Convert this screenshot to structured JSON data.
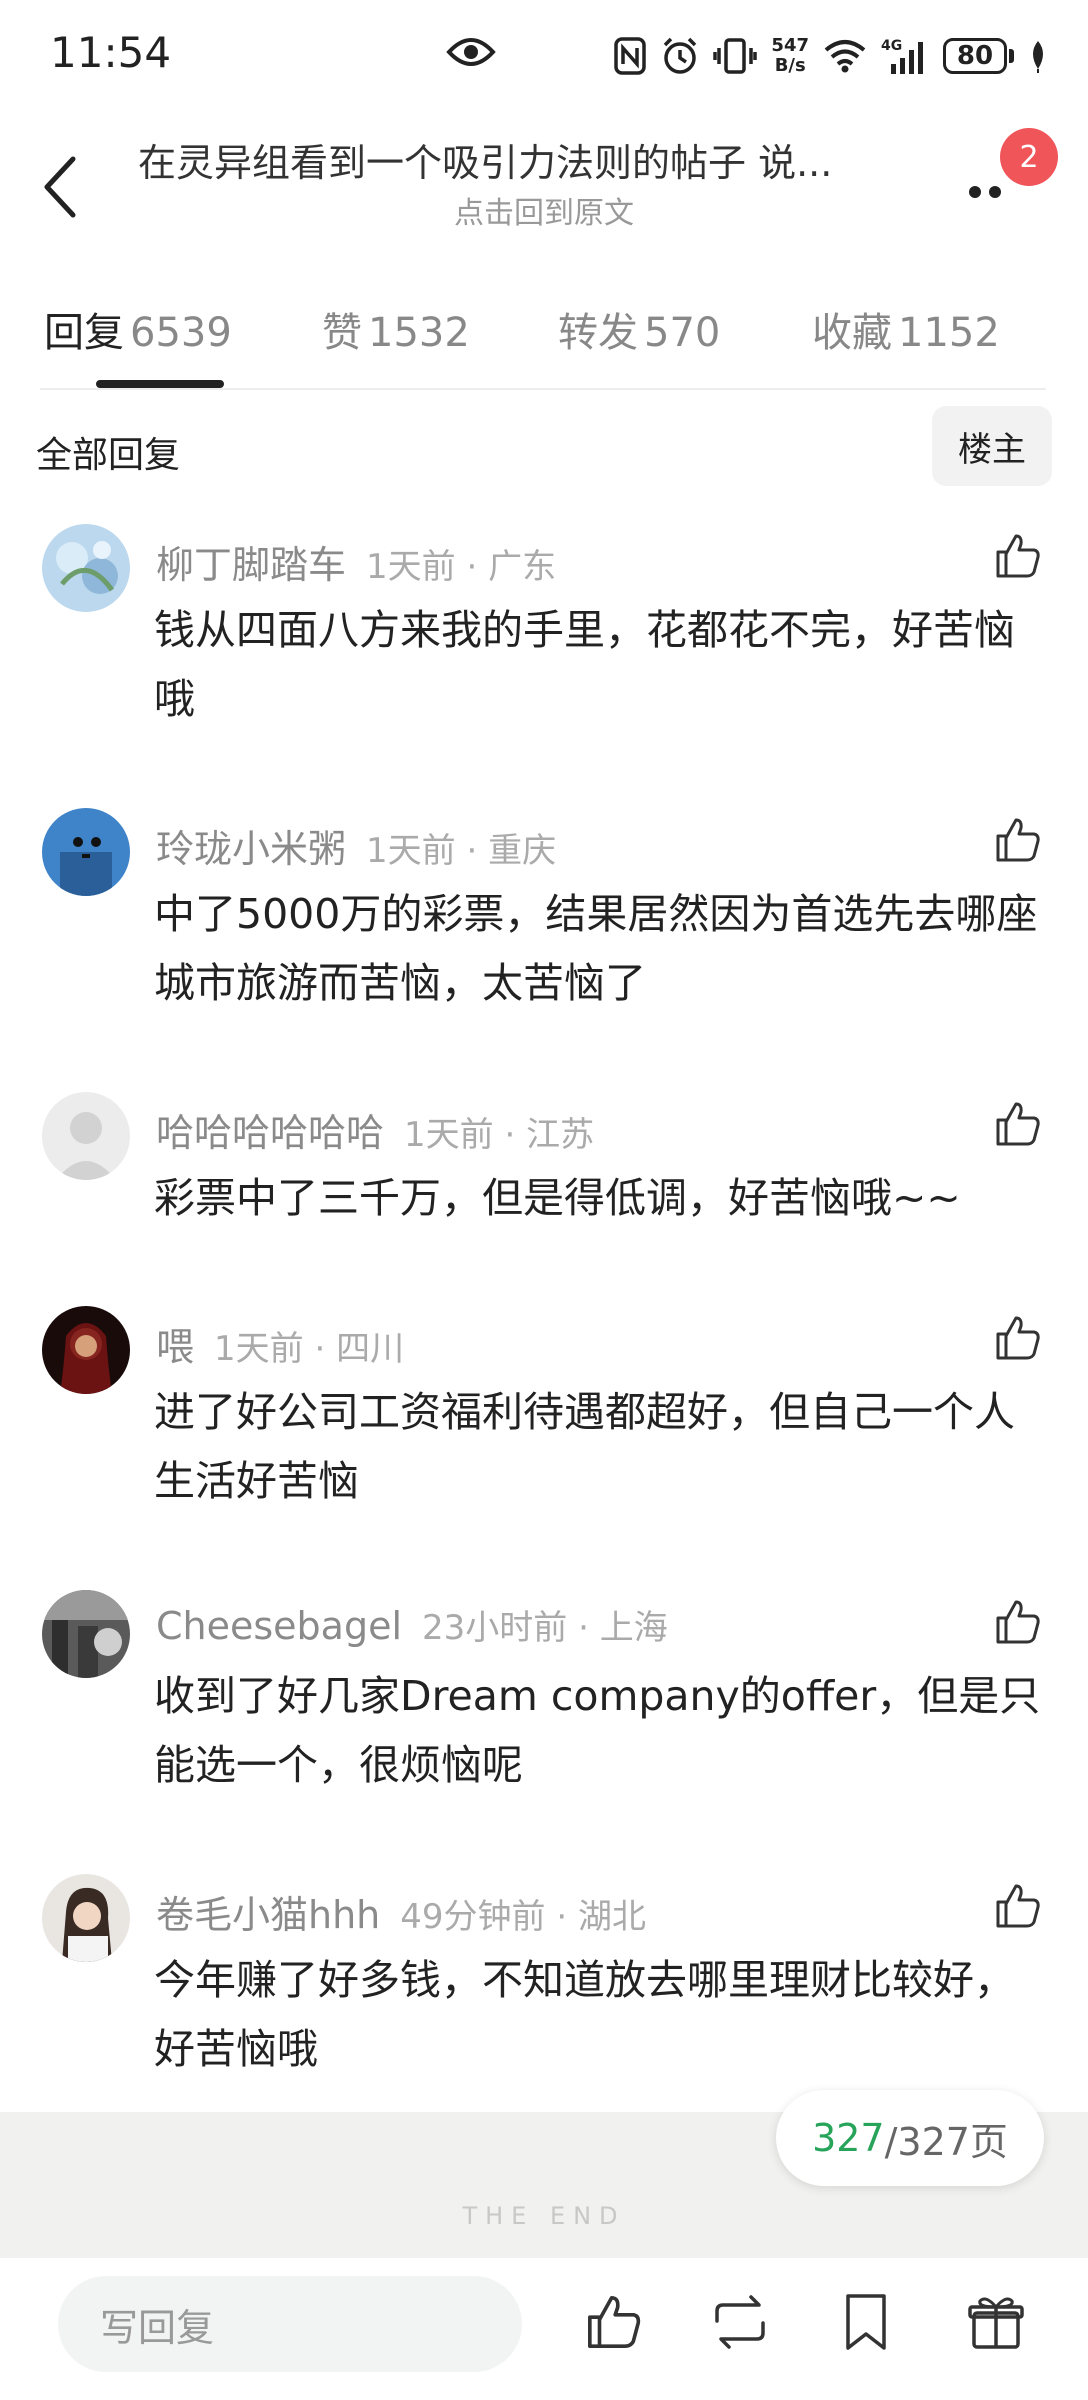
{
  "status_bar": {
    "time": "11:54",
    "net_speed_value": "547",
    "net_speed_unit": "B/s",
    "battery": "80",
    "icons": [
      "eye-icon",
      "nfc-icon",
      "alarm-icon",
      "vibrate-icon",
      "wifi-icon",
      "signal-4g-icon",
      "battery-icon",
      "leaf-icon"
    ]
  },
  "header": {
    "title": "在灵异组看到一个吸引力法则的帖子 说...",
    "subtitle": "点击回到原文",
    "badge_count": "2"
  },
  "tabs": [
    {
      "label": "回复",
      "count": "6539",
      "active": true
    },
    {
      "label": "赞",
      "count": "1532",
      "active": false
    },
    {
      "label": "转发",
      "count": "570",
      "active": false
    },
    {
      "label": "收藏",
      "count": "1152",
      "active": false
    }
  ],
  "filter": {
    "label": "全部回复",
    "owner_button": "楼主"
  },
  "comments": [
    {
      "username": "柳丁脚踏车",
      "time": "1天前",
      "location": "广东",
      "text": "钱从四面八方来我的手里，花都花不完，好苦恼哦"
    },
    {
      "username": "玲珑小米粥",
      "time": "1天前",
      "location": "重庆",
      "text": "中了5000万的彩票，结果居然因为首选先去哪座城市旅游而苦恼，太苦恼了"
    },
    {
      "username": "哈哈哈哈哈哈",
      "time": "1天前",
      "location": "江苏",
      "text": "彩票中了三千万，但是得低调，好苦恼哦~~"
    },
    {
      "username": "喂",
      "time": "1天前",
      "location": "四川",
      "text": "进了好公司工资福利待遇都超好，但自己一个人生活好苦恼"
    },
    {
      "username": "Cheesebagel",
      "time": "23小时前",
      "location": "上海",
      "text": "收到了好几家Dream company的offer，但是只能选一个，很烦恼呢"
    },
    {
      "username": "卷毛小猫hhh",
      "time": "49分钟前",
      "location": "湖北",
      "text": "今年赚了好多钱，不知道放去哪里理财比较好，好苦恼哦"
    }
  ],
  "end": {
    "text": "THE END",
    "current_page": "327",
    "total_pages": "/327页"
  },
  "bottom_bar": {
    "reply_placeholder": "写回复",
    "icons": [
      "like-icon",
      "repost-icon",
      "bookmark-icon",
      "gift-icon"
    ]
  },
  "colors": {
    "badge": "#f0555a",
    "page_current": "#27a35a",
    "end_band": "#f1f1ef"
  }
}
